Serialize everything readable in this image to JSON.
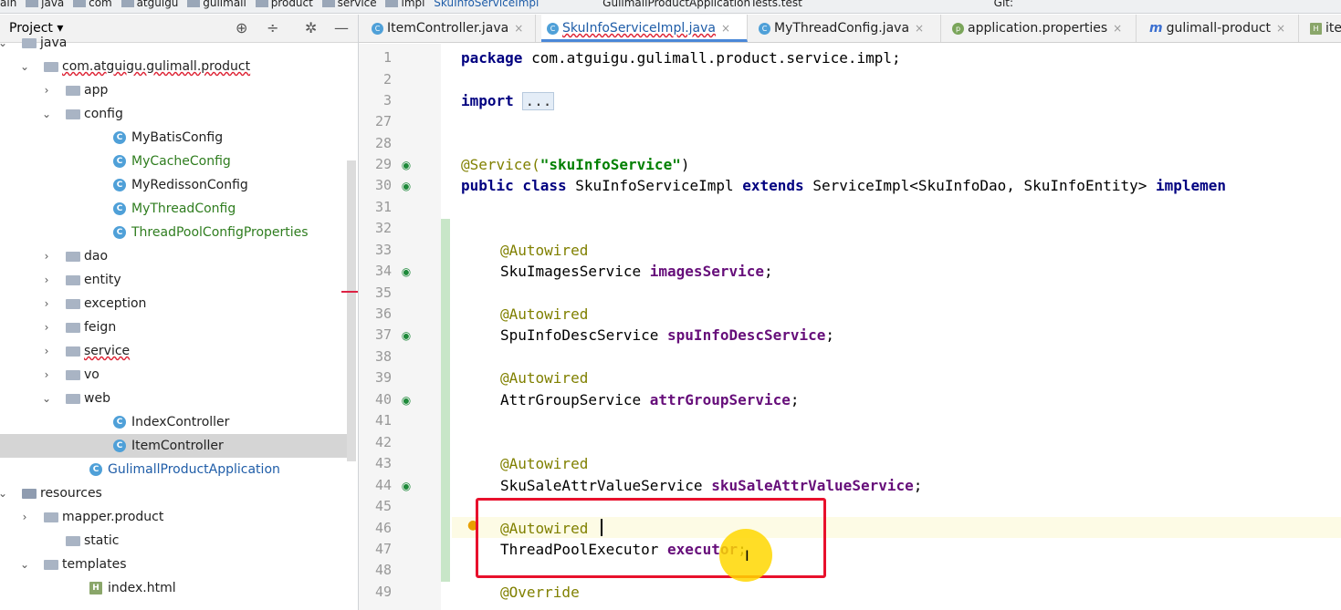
{
  "breadcrumb": [
    "ain",
    "java",
    "com",
    "atguigu",
    "gulimall",
    "product",
    "service",
    "impl",
    "SkuInfoServiceImpl",
    "GulimallProductApplicationTests.test",
    "Git:"
  ],
  "project_panel": {
    "title": "Project ▾",
    "tree": [
      {
        "label": "java",
        "kind": "folder",
        "expanded": true
      },
      {
        "label": "com.atguigu.gulimall.product",
        "kind": "package",
        "expanded": true
      },
      {
        "label": "app",
        "kind": "folder",
        "expanded": false
      },
      {
        "label": "config",
        "kind": "folder",
        "expanded": true
      },
      {
        "label": "MyBatisConfig",
        "kind": "class"
      },
      {
        "label": "MyCacheConfig",
        "kind": "class"
      },
      {
        "label": "MyRedissonConfig",
        "kind": "class"
      },
      {
        "label": "MyThreadConfig",
        "kind": "class"
      },
      {
        "label": "ThreadPoolConfigProperties",
        "kind": "class"
      },
      {
        "label": "dao",
        "kind": "folder",
        "expanded": false
      },
      {
        "label": "entity",
        "kind": "folder",
        "expanded": false
      },
      {
        "label": "exception",
        "kind": "folder",
        "expanded": false
      },
      {
        "label": "feign",
        "kind": "folder",
        "expanded": false
      },
      {
        "label": "service",
        "kind": "folder",
        "expanded": false
      },
      {
        "label": "vo",
        "kind": "folder",
        "expanded": false
      },
      {
        "label": "web",
        "kind": "folder",
        "expanded": true
      },
      {
        "label": "IndexController",
        "kind": "class"
      },
      {
        "label": "ItemController",
        "kind": "class",
        "selected": true
      },
      {
        "label": "GulimallProductApplication",
        "kind": "class"
      },
      {
        "label": "resources",
        "kind": "folder",
        "expanded": true
      },
      {
        "label": "mapper.product",
        "kind": "folder",
        "expanded": false
      },
      {
        "label": "static",
        "kind": "folder"
      },
      {
        "label": "templates",
        "kind": "folder",
        "expanded": true
      },
      {
        "label": "index.html",
        "kind": "html"
      }
    ]
  },
  "tabs": [
    "ItemController.java",
    "SkuInfoServiceImpl.java",
    "MyThreadConfig.java",
    "application.properties",
    "gulimall-product",
    "ite"
  ],
  "active_tab": "SkuInfoServiceImpl.java",
  "line_numbers": [
    "1",
    "2",
    "3",
    "27",
    "28",
    "29",
    "30",
    "31",
    "32",
    "33",
    "34",
    "35",
    "36",
    "37",
    "38",
    "39",
    "40",
    "41",
    "42",
    "43",
    "44",
    "45",
    "46",
    "47",
    "48",
    "49"
  ],
  "code": {
    "l1_kw": "package",
    "l1_rest": " com.atguigu.gulimall.product.service.impl;",
    "l3_kw": "import",
    "l3_fold": "...",
    "l29_an": "@Service(",
    "l29_str": "\"skuInfoService\"",
    "l29_close": ")",
    "l30_kw1": "public class",
    "l30_mid": " SkuInfoServiceImpl ",
    "l30_kw2": "extends",
    "l30_rest": " ServiceImpl<SkuInfoDao, SkuInfoEntity> ",
    "l30_kw3": "implemen",
    "autowired": "@Autowired",
    "l34_type": "SkuImagesService ",
    "l34_field": "imagesService",
    "l37_type": "SpuInfoDescService ",
    "l37_field": "spuInfoDescService",
    "l40_type": "AttrGroupService ",
    "l40_field": "attrGroupService",
    "l44_type": "SkuSaleAttrValueService ",
    "l44_field": "skuSaleAttrValueService",
    "l47_type": "ThreadPoolExecutor ",
    "l47_field": "executor",
    "semicolon": ";",
    "l49_an": "@Override"
  }
}
